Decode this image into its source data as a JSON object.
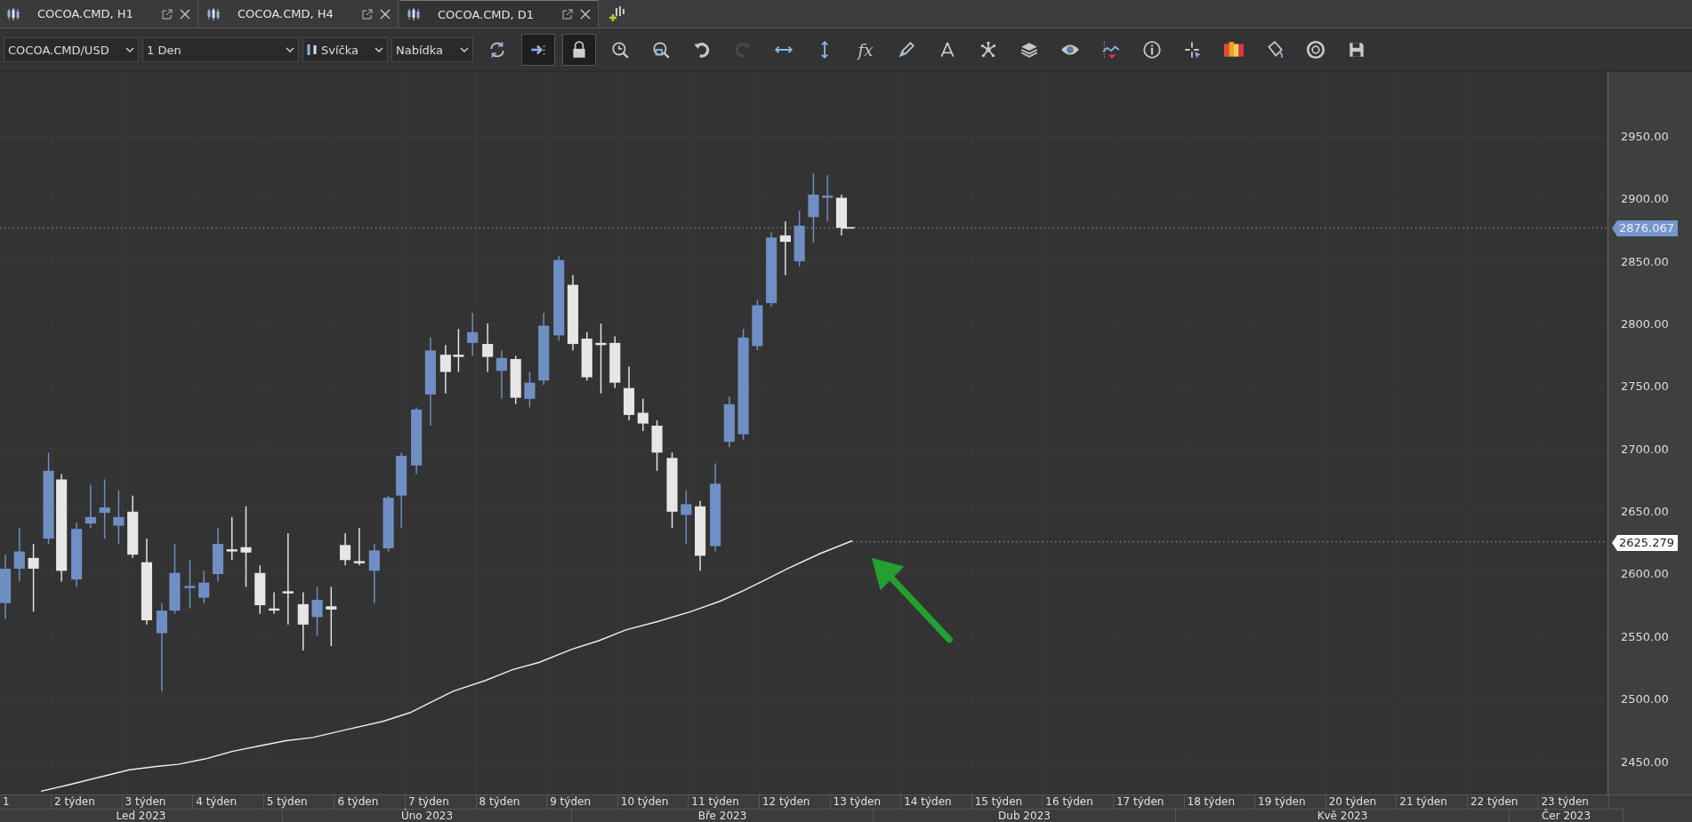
{
  "tabs": [
    {
      "label": "COCOA.CMD, H1",
      "selected": false
    },
    {
      "label": "COCOA.CMD, H4",
      "selected": false
    },
    {
      "label": "COCOA.CMD, D1",
      "selected": true
    }
  ],
  "toolbar": {
    "dropdowns": [
      {
        "value": "COCOA.CMD/USD"
      },
      {
        "value": "1 Den"
      },
      {
        "value": "Svíčka"
      },
      {
        "value": "Nabídka"
      }
    ],
    "buttons": [
      {
        "on": false,
        "disabled": false
      },
      {
        "on": true,
        "disabled": false
      },
      {
        "on": true,
        "disabled": false
      },
      {
        "on": false,
        "disabled": false
      },
      {
        "on": false,
        "disabled": false
      },
      {
        "on": false,
        "disabled": false
      },
      {
        "on": false,
        "disabled": true
      },
      {
        "on": false,
        "disabled": false
      },
      {
        "on": false,
        "disabled": false
      },
      {
        "label": "fx",
        "on": false,
        "disabled": false
      },
      {
        "on": false,
        "disabled": false
      },
      {
        "on": false,
        "disabled": false
      },
      {
        "on": false,
        "disabled": false
      },
      {
        "on": false,
        "disabled": false
      },
      {
        "on": false,
        "disabled": false
      },
      {
        "on": false,
        "disabled": false
      },
      {
        "on": false,
        "disabled": false
      },
      {
        "on": false,
        "disabled": false
      },
      {
        "on": false,
        "disabled": false
      },
      {
        "on": false,
        "disabled": false
      },
      {
        "on": false,
        "disabled": false
      },
      {
        "on": false,
        "disabled": false
      }
    ]
  },
  "price_axis": {
    "ticks": [
      "2950.00",
      "2900.00",
      "2850.00",
      "2800.00",
      "2750.00",
      "2700.00",
      "2650.00",
      "2600.00",
      "2550.00",
      "2500.00",
      "2450.00"
    ],
    "markers": [
      {
        "value": "2876.067",
        "kind": "price"
      },
      {
        "value": "2625.279",
        "kind": "indicator"
      }
    ]
  },
  "time_axis": {
    "weeks": [
      "1",
      "2 týden",
      "3 týden",
      "4 týden",
      "5 týden",
      "6 týden",
      "7 týden",
      "8 týden",
      "9 týden",
      "10 týden",
      "11 týden",
      "12 týden",
      "13 týden",
      "14 týden",
      "15 týden",
      "16 týden",
      "17 týden",
      "18 týden",
      "19 týden",
      "20 týden",
      "21 týden",
      "22 týden",
      "23 týden"
    ],
    "months": [
      "Led 2023",
      "Úno 2023",
      "Bře 2023",
      "Dub 2023",
      "Kvě 2023",
      "Čer 2023"
    ]
  }
}
